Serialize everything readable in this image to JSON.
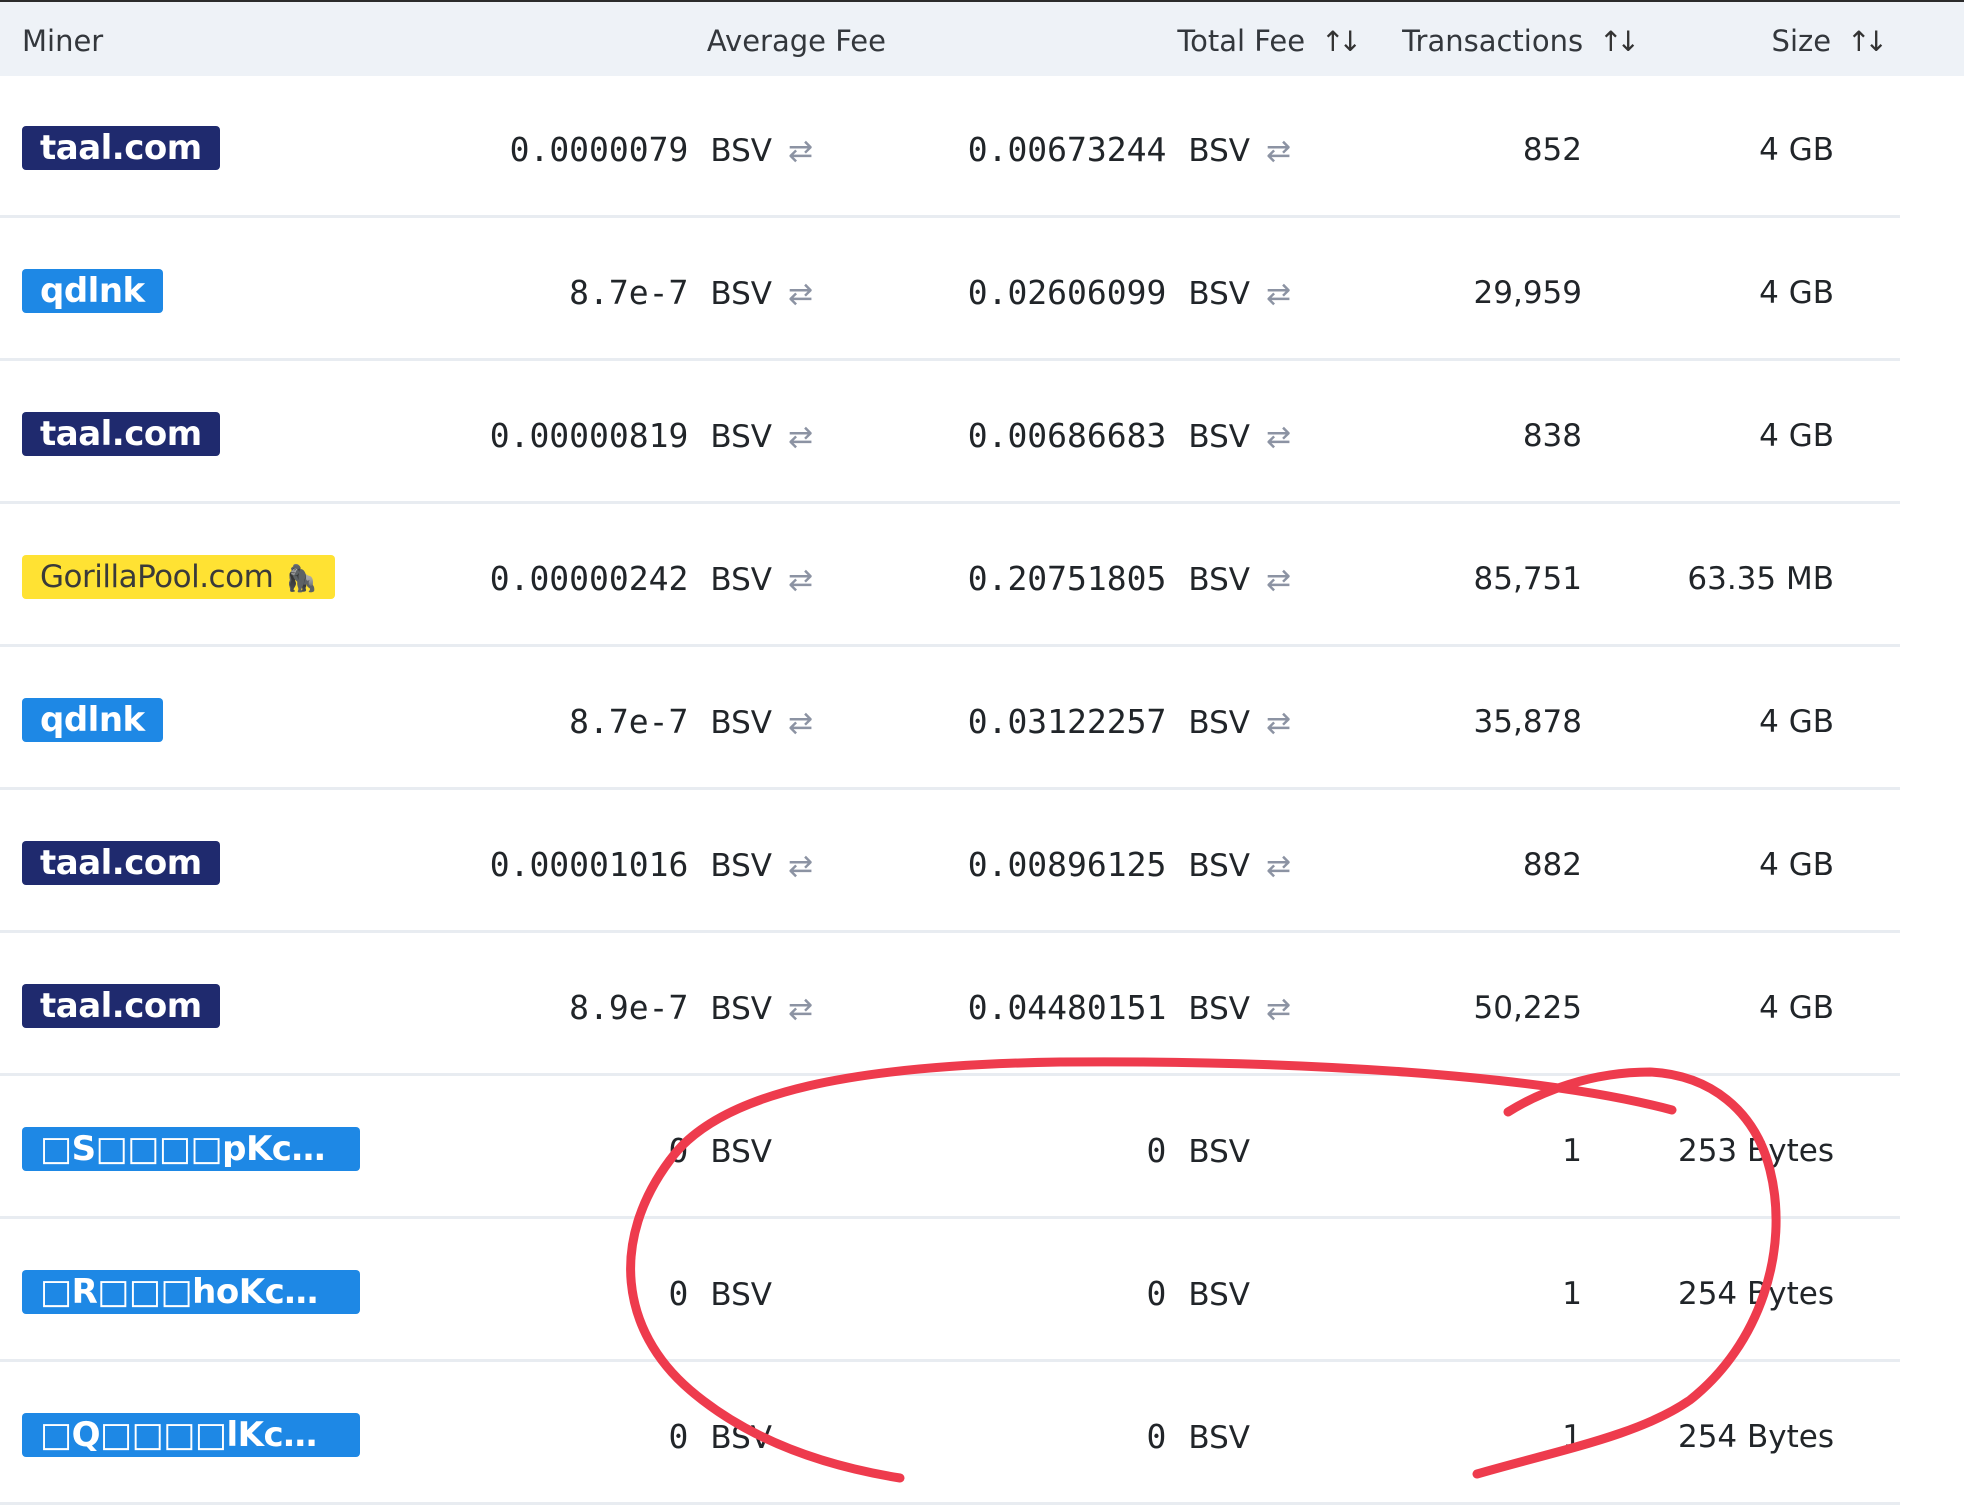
{
  "header": {
    "miner": "Miner",
    "average_fee": "Average Fee",
    "total_fee": "Total Fee",
    "transactions": "Transactions",
    "size": "Size",
    "sort_glyph": "↑↓"
  },
  "swap_glyph": "⇄",
  "rows": [
    {
      "miner": "taal.com",
      "badge": "dark",
      "avg_fee": "0.0000079",
      "avg_unit": "BSV",
      "total_fee": "0.00673244",
      "total_unit": "BSV",
      "transactions": "852",
      "size": "4 GB",
      "swap": true
    },
    {
      "miner": "qdlnk",
      "badge": "blue",
      "avg_fee": "8.7e-7",
      "avg_unit": "BSV",
      "total_fee": "0.02606099",
      "total_unit": "BSV",
      "transactions": "29,959",
      "size": "4 GB",
      "swap": true
    },
    {
      "miner": "taal.com",
      "badge": "dark",
      "avg_fee": "0.00000819",
      "avg_unit": "BSV",
      "total_fee": "0.00686683",
      "total_unit": "BSV",
      "transactions": "838",
      "size": "4 GB",
      "swap": true
    },
    {
      "miner": "GorillaPool.com",
      "badge": "yellow",
      "avg_fee": "0.00000242",
      "avg_unit": "BSV",
      "total_fee": "0.20751805",
      "total_unit": "BSV",
      "transactions": "85,751",
      "size": "63.35 MB",
      "swap": true
    },
    {
      "miner": "qdlnk",
      "badge": "blue",
      "avg_fee": "8.7e-7",
      "avg_unit": "BSV",
      "total_fee": "0.03122257",
      "total_unit": "BSV",
      "transactions": "35,878",
      "size": "4 GB",
      "swap": true
    },
    {
      "miner": "taal.com",
      "badge": "dark",
      "avg_fee": "0.00001016",
      "avg_unit": "BSV",
      "total_fee": "0.00896125",
      "total_unit": "BSV",
      "transactions": "882",
      "size": "4 GB",
      "swap": true
    },
    {
      "miner": "taal.com",
      "badge": "dark",
      "avg_fee": "8.9e-7",
      "avg_unit": "BSV",
      "total_fee": "0.04480151",
      "total_unit": "BSV",
      "transactions": "50,225",
      "size": "4 GB",
      "swap": true
    },
    {
      "miner": "□S□□□□pKc□□□mm...",
      "badge": "blue-wide",
      "avg_fee": "0",
      "avg_unit": "BSV",
      "total_fee": "0",
      "total_unit": "BSV",
      "transactions": "1",
      "size": "253 Bytes",
      "swap": false
    },
    {
      "miner": "□R□□□hoKc□□□m...",
      "badge": "blue-wide",
      "avg_fee": "0",
      "avg_unit": "BSV",
      "total_fee": "0",
      "total_unit": "BSV",
      "transactions": "1",
      "size": "254 Bytes",
      "swap": false
    },
    {
      "miner": "□Q□□□□lKc□□□mm...",
      "badge": "blue-wide",
      "avg_fee": "0",
      "avg_unit": "BSV",
      "total_fee": "0",
      "total_unit": "BSV",
      "transactions": "1",
      "size": "254 Bytes",
      "swap": false
    }
  ],
  "annotation": {
    "color": "#ee3b4d"
  }
}
